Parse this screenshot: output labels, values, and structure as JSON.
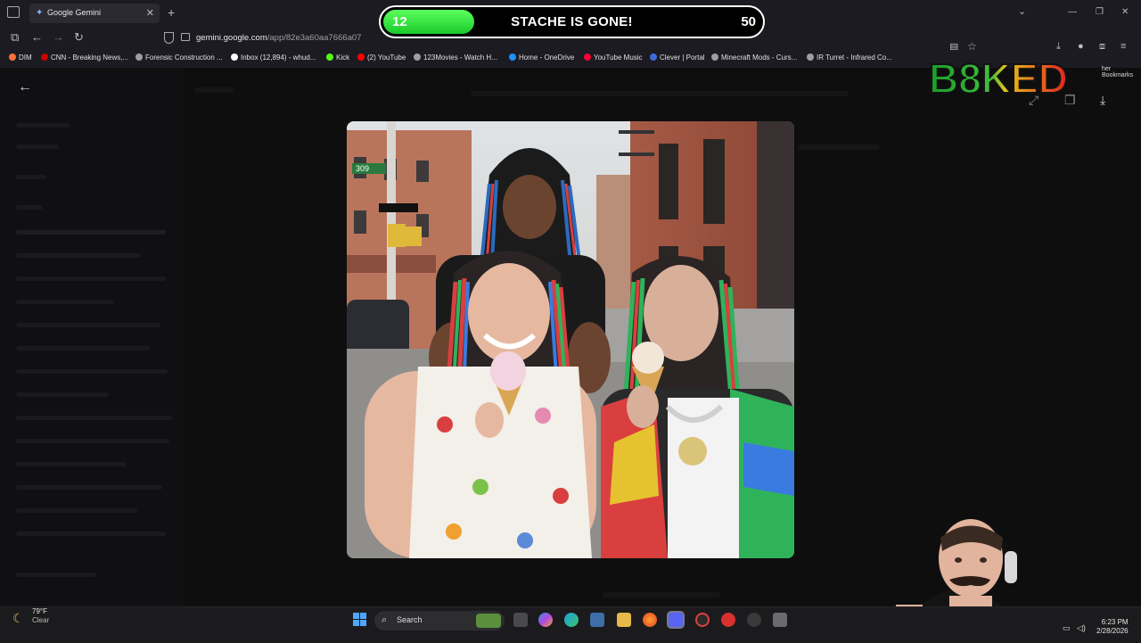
{
  "browser": {
    "tab_title": "Google Gemini",
    "url_domain": "gemini.google.com",
    "url_path": "/app/82e3a60aa7666a07",
    "bookmarks": [
      {
        "label": "DIM",
        "color": "#ff7139"
      },
      {
        "label": "CNN - Breaking News,...",
        "color": "#cc0000"
      },
      {
        "label": "Forensic Construction ...",
        "color": "#9aa0a6"
      },
      {
        "label": "Inbox (12,894) - whud...",
        "color": "#ffffff"
      },
      {
        "label": "Kick",
        "color": "#53fc18"
      },
      {
        "label": "(2) YouTube",
        "color": "#ff0000"
      },
      {
        "label": "123Movies - Watch H...",
        "color": "#9aa0a6"
      },
      {
        "label": "Home - OneDrive",
        "color": "#1e90ff"
      },
      {
        "label": "YouTube Music",
        "color": "#ff0033"
      },
      {
        "label": "Clever | Portal",
        "color": "#3f6ad8"
      },
      {
        "label": "Minecraft Mods - Curs...",
        "color": "#9aa0a6"
      },
      {
        "label": "IR Turret - Infrared Co...",
        "color": "#9aa0a6"
      }
    ],
    "other_bookmarks": "her Bookmarks"
  },
  "overlay": {
    "counter_current": "12",
    "counter_label": "STACHE IS GONE!",
    "counter_goal": "50",
    "counter_fraction": 0.24,
    "logo_text": "B8KED"
  },
  "taskbar": {
    "temperature": "79°F",
    "condition": "Clear",
    "search_label": "Search",
    "time": "6:23 PM",
    "date": "2/28/2026"
  }
}
